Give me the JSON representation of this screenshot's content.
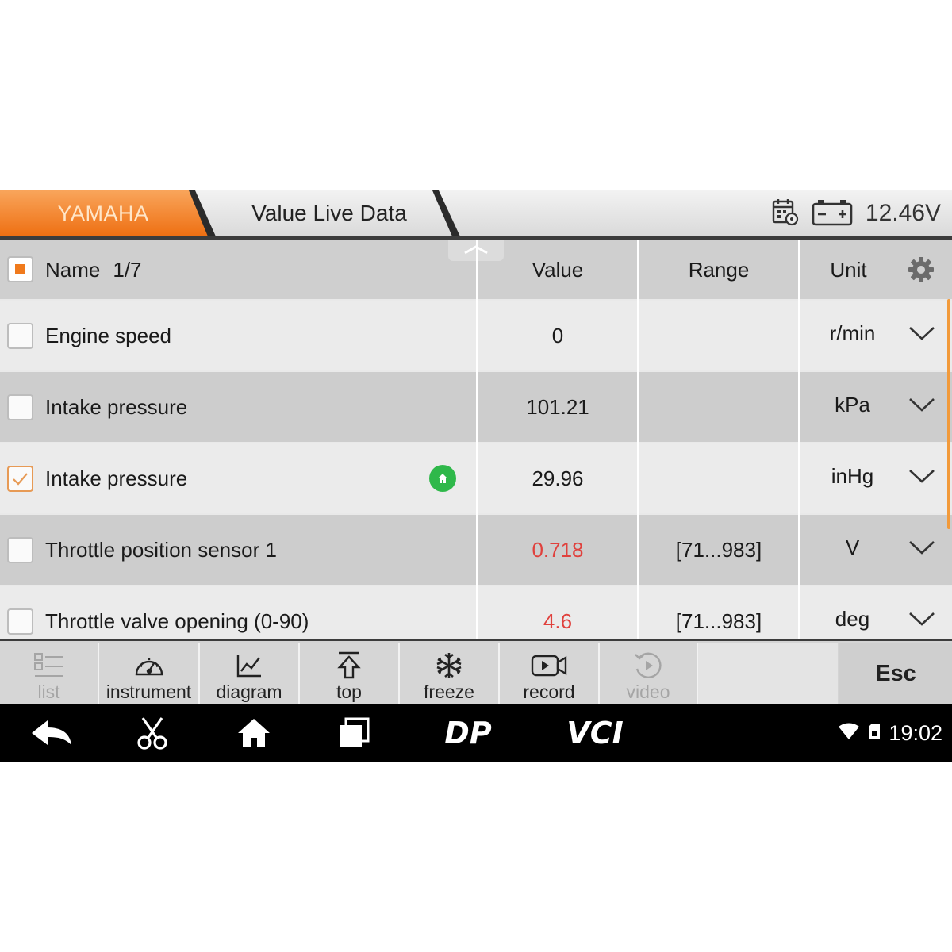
{
  "header": {
    "brand": "YAMAHA",
    "page_title": "Value Live Data",
    "voltage": "12.46V",
    "icons": [
      "calendar-gear-icon",
      "battery-icon"
    ]
  },
  "table": {
    "columns": {
      "name": "Name",
      "page": "1/7",
      "value": "Value",
      "range": "Range",
      "unit": "Unit"
    },
    "rows": [
      {
        "name": "Engine speed",
        "value": "0",
        "range": "",
        "unit": "r/min",
        "checked": false,
        "value_color": "#1a1a1a"
      },
      {
        "name": "Intake pressure",
        "value": "101.21",
        "range": "",
        "unit": "kPa",
        "checked": false,
        "value_color": "#1a1a1a"
      },
      {
        "name": "Intake pressure",
        "value": "29.96",
        "range": "",
        "unit": "inHg",
        "checked": true,
        "value_color": "#1a1a1a",
        "badge": "home-badge-icon"
      },
      {
        "name": "Throttle position sensor 1",
        "value": "0.718",
        "range": "[71...983]",
        "unit": "V",
        "checked": false,
        "value_color": "#e0413d"
      },
      {
        "name": "Throttle valve opening (0-90)",
        "value": "4.6",
        "range": "[71...983]",
        "unit": "deg",
        "checked": false,
        "value_color": "#e0413d"
      }
    ]
  },
  "toolbar": {
    "list": "list",
    "instrument": "instrument",
    "diagram": "diagram",
    "top": "top",
    "freeze": "freeze",
    "record": "record",
    "video": "video",
    "esc": "Esc"
  },
  "status_bar": {
    "logo_dp": "DP",
    "logo_vci": "VCI",
    "time": "19:02"
  },
  "colors": {
    "accent_orange": "#f07a1d",
    "alert_red": "#e0413d",
    "badge_green": "#2fb84a"
  }
}
